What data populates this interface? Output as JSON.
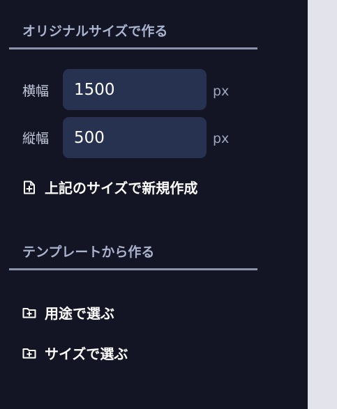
{
  "original_size": {
    "section_title": "オリジナルサイズで作る",
    "width_label": "横幅",
    "width_value": "1500",
    "width_unit": "px",
    "height_label": "縦幅",
    "height_value": "500",
    "height_unit": "px",
    "create_label": "上記のサイズで新規作成",
    "create_icon": "file-plus-icon"
  },
  "template": {
    "section_title": "テンプレートから作る",
    "items": [
      {
        "label": "用途で選ぶ",
        "icon": "folder-plus-icon"
      },
      {
        "label": "サイズで選ぶ",
        "icon": "folder-plus-icon"
      }
    ]
  },
  "colors": {
    "panel_bg": "#131424",
    "input_bg": "#263250",
    "divider": "#8c93ad",
    "section_title": "#aab4cf",
    "right_area_bg": "#e3e3ec"
  }
}
